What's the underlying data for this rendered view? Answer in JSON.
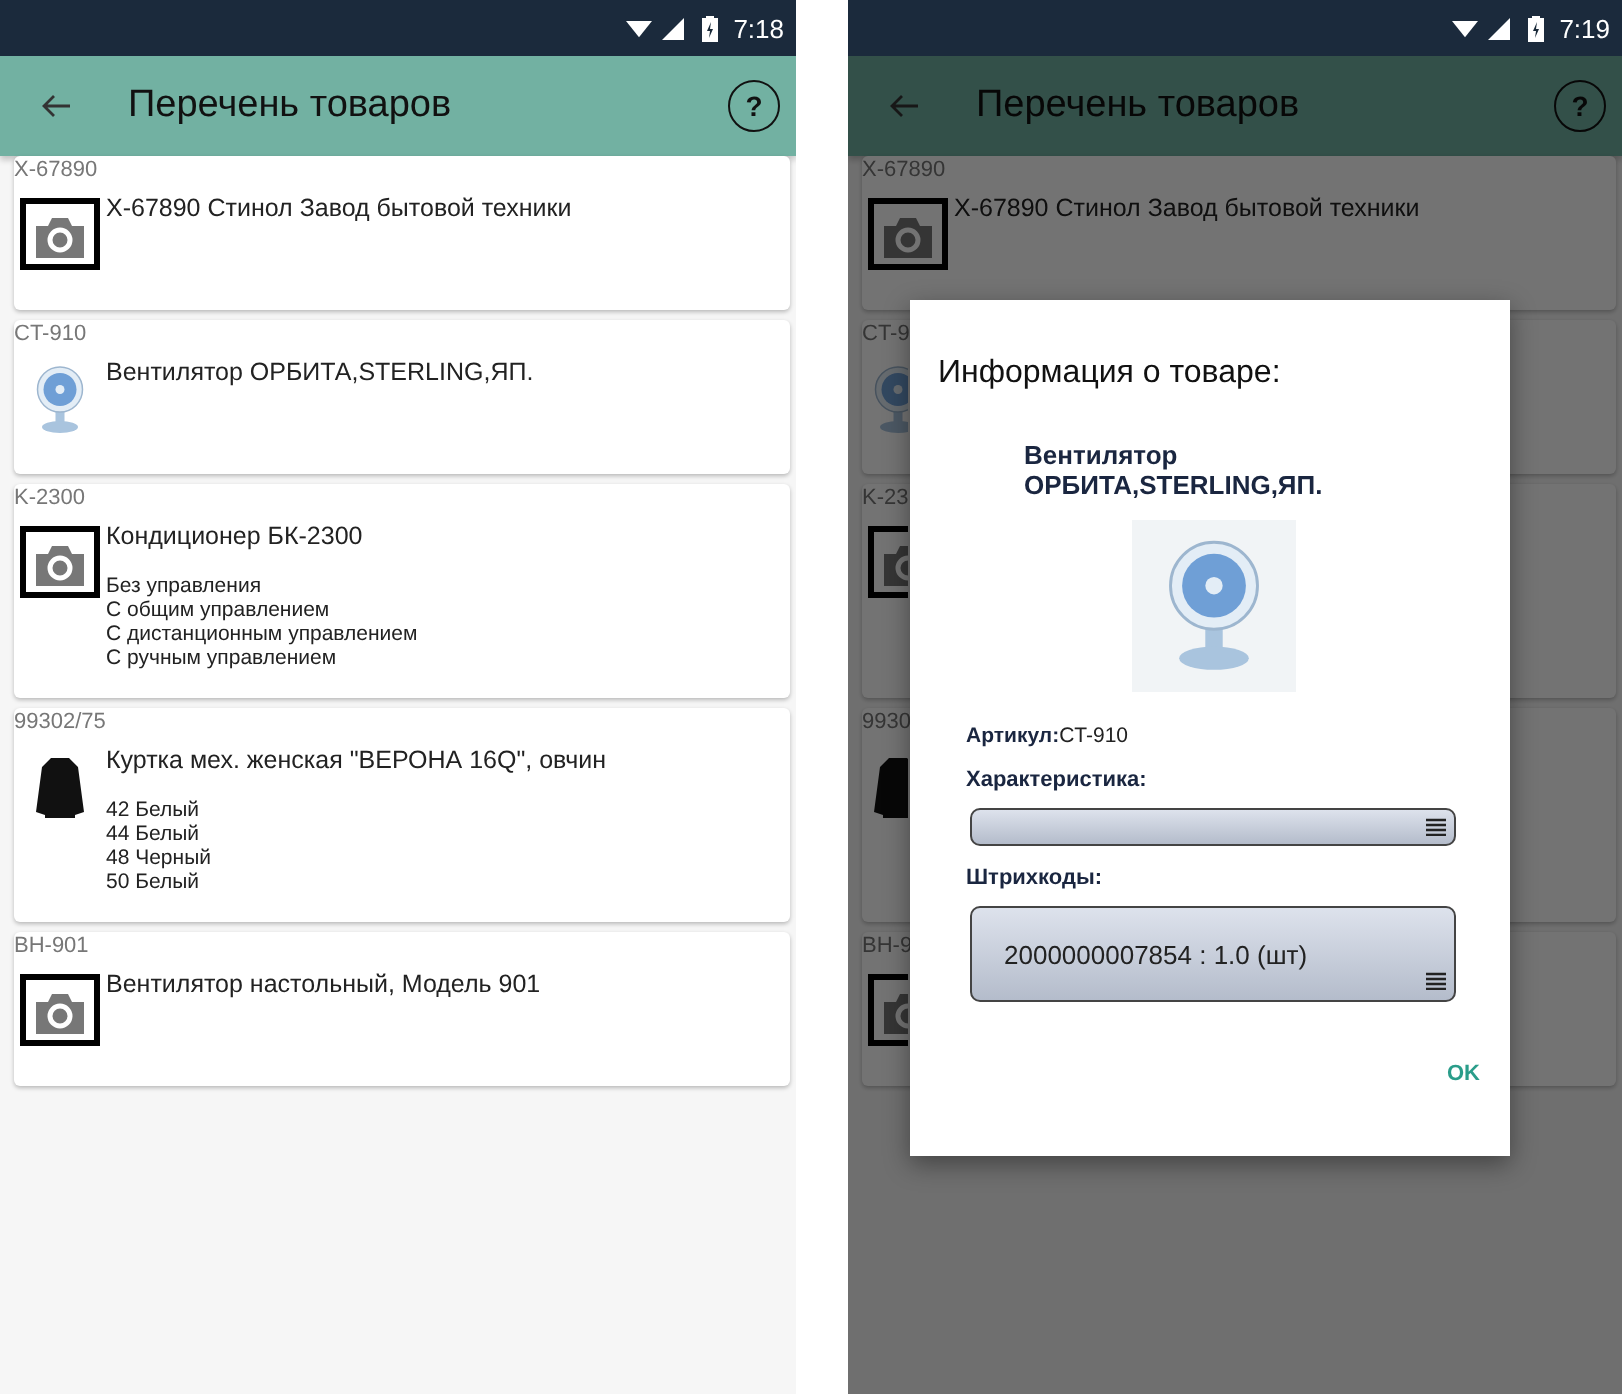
{
  "screens": [
    {
      "status_bar": {
        "time": "7:18"
      },
      "app_bar": {
        "title": "Перечень товаров",
        "help": "?"
      },
      "products": [
        {
          "code": "X-67890",
          "name": "X-67890 Стинол Завод бытовой техники",
          "kind": "camera"
        },
        {
          "code": "CT-910",
          "name": "Вентилятор ОРБИТА,STERLING,ЯП.",
          "kind": "fan"
        },
        {
          "code": "K-2300",
          "name": "Кондиционер БК-2300",
          "kind": "camera",
          "variants": [
            "Без управления",
            "С общим управлением",
            "С дистанционным управлением",
            "С ручным управлением"
          ]
        },
        {
          "code": "99302/75",
          "name": "Куртка мех. женская \"ВЕРОНА 16Q\", овчин",
          "kind": "jacket",
          "variants": [
            "42 Белый",
            "44 Белый",
            "48 Черный",
            "50 Белый"
          ]
        },
        {
          "code": "BH-901",
          "name": "Вентилятор настольный, Модель 901",
          "kind": "camera"
        }
      ]
    },
    {
      "status_bar": {
        "time": "7:19"
      },
      "app_bar": {
        "title": "Перечень товаров",
        "help": "?"
      },
      "products": [
        {
          "code": "X-67890",
          "name": "X-67890 Стинол Завод бытовой техники",
          "kind": "camera"
        },
        {
          "code": "CT-9",
          "kind": "fan"
        },
        {
          "code": "K-23",
          "kind": "camera"
        },
        {
          "code": "9930",
          "kind": "jacket"
        },
        {
          "code": "BH-9",
          "kind": "camera"
        }
      ],
      "dialog": {
        "title": "Информация о товаре:",
        "product_name": "Вентилятор ОРБИТА,STERLING,ЯП.",
        "article": "**Артикул:**CT-910",
        "characteristic_label": "Характеристика:",
        "barcodes_label": "Штрихкоды:",
        "barcode": "2000000007854 : 1.0 (шт)",
        "ok": "OK"
      }
    }
  ]
}
